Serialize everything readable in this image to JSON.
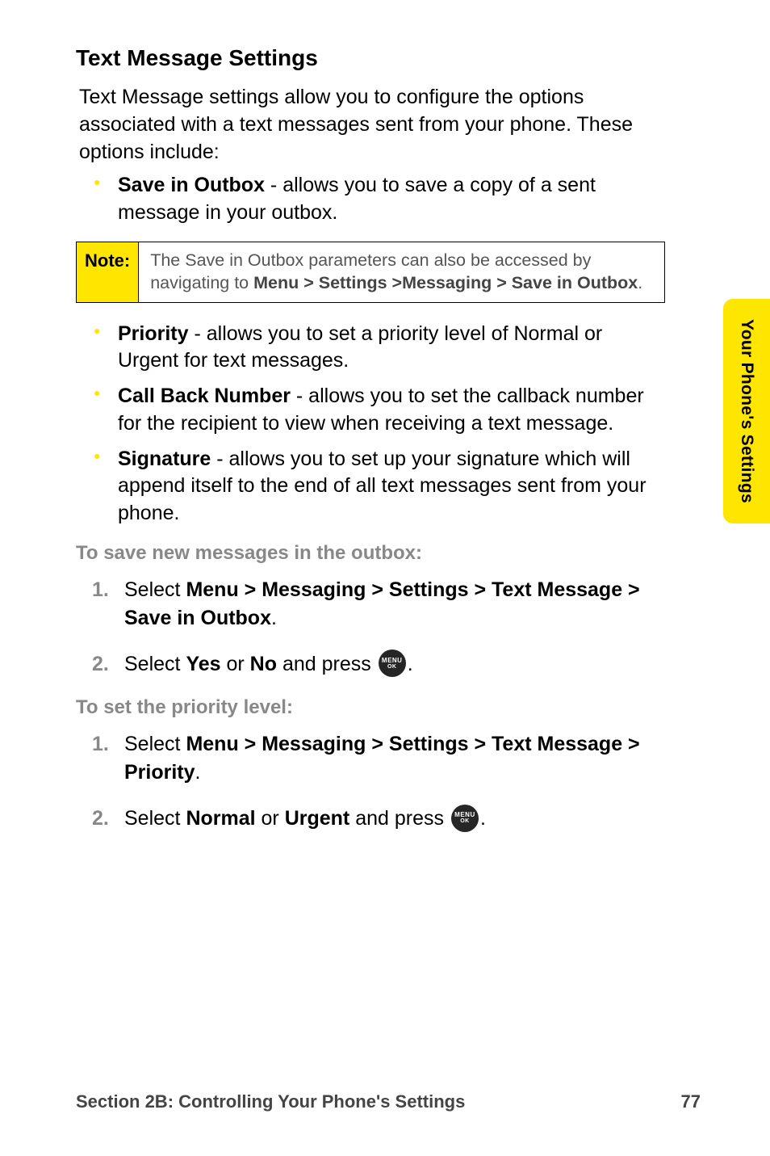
{
  "sideTab": "Your Phone's Settings",
  "heading": "Text Message Settings",
  "intro": "Text Message settings allow you to configure the options associated with a text messages sent from your phone. These options include:",
  "bullet1": {
    "title": "Save in Outbox",
    "rest": " - allows you to save a copy of a sent message in your outbox."
  },
  "note": {
    "label": "Note:",
    "pre": "The Save in Outbox parameters can also be accessed by navigating to ",
    "strong": "Menu > Settings >Messaging > Save in Outbox",
    "post": "."
  },
  "bullet2": {
    "title": "Priority",
    "rest": " - allows you to set a priority level of Normal or Urgent for text messages."
  },
  "bullet3": {
    "title": "Call Back Number",
    "rest": " - allows you to set the callback number for the recipient to view when receiving a text message."
  },
  "bullet4": {
    "title": "Signature",
    "rest": " - allows you to set up your signature which will append itself to the end of all text messages sent from your phone."
  },
  "sub1": "To save new messages in the outbox:",
  "steps1": {
    "s1_pre": "Select ",
    "s1_bold": "Menu > Messaging > Settings > Text Message > Save in Outbox",
    "s1_post": ".",
    "s2_pre": "Select ",
    "s2_b1": "Yes",
    "s2_mid": " or ",
    "s2_b2": "No",
    "s2_after": " and press ",
    "s2_end": "."
  },
  "sub2": "To set the priority level:",
  "steps2": {
    "s1_pre": "Select ",
    "s1_bold": "Menu > Messaging > Settings > Text Message > Priority",
    "s1_post": ".",
    "s2_pre": "Select ",
    "s2_b1": "Normal",
    "s2_mid": " or ",
    "s2_b2": "Urgent",
    "s2_after": " and press ",
    "s2_end": "."
  },
  "iconMenu": {
    "l1": "MENU",
    "l2": "OK"
  },
  "footer": {
    "left": "Section 2B: Controlling Your Phone's Settings",
    "right": "77"
  }
}
